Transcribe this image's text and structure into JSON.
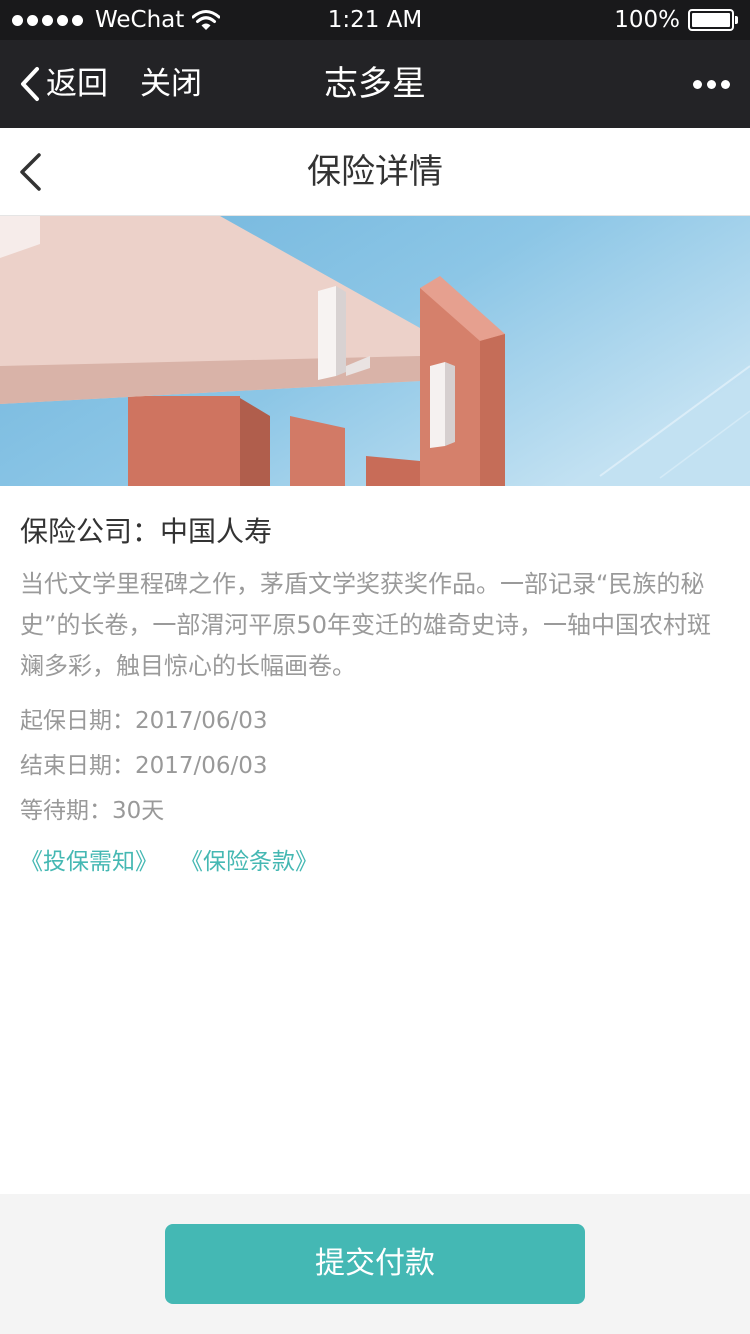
{
  "status_bar": {
    "carrier": "WeChat",
    "time": "1:21 AM",
    "battery": "100%"
  },
  "wechat_nav": {
    "back_label": "返回",
    "close_label": "关闭",
    "title": "志多星"
  },
  "page": {
    "title": "保险详情"
  },
  "insurance": {
    "company": "保险公司：中国人寿",
    "description": "当代文学里程碑之作，茅盾文学奖获奖作品。一部记录“民族的秘史”的长卷，一部渭河平原50年变迁的雄奇史诗，一轴中国农村斑斓多彩，触目惊心的长幅画卷。",
    "start_date": "起保日期：2017/06/03",
    "end_date": "结束日期：2017/06/03",
    "waiting_period": "等待期：30天"
  },
  "links": {
    "notice": "《投保需知》",
    "terms": "《保险条款》"
  },
  "footer": {
    "submit_label": "提交付款"
  },
  "colors": {
    "accent": "#44b8b4",
    "nav_bg": "#232326"
  }
}
